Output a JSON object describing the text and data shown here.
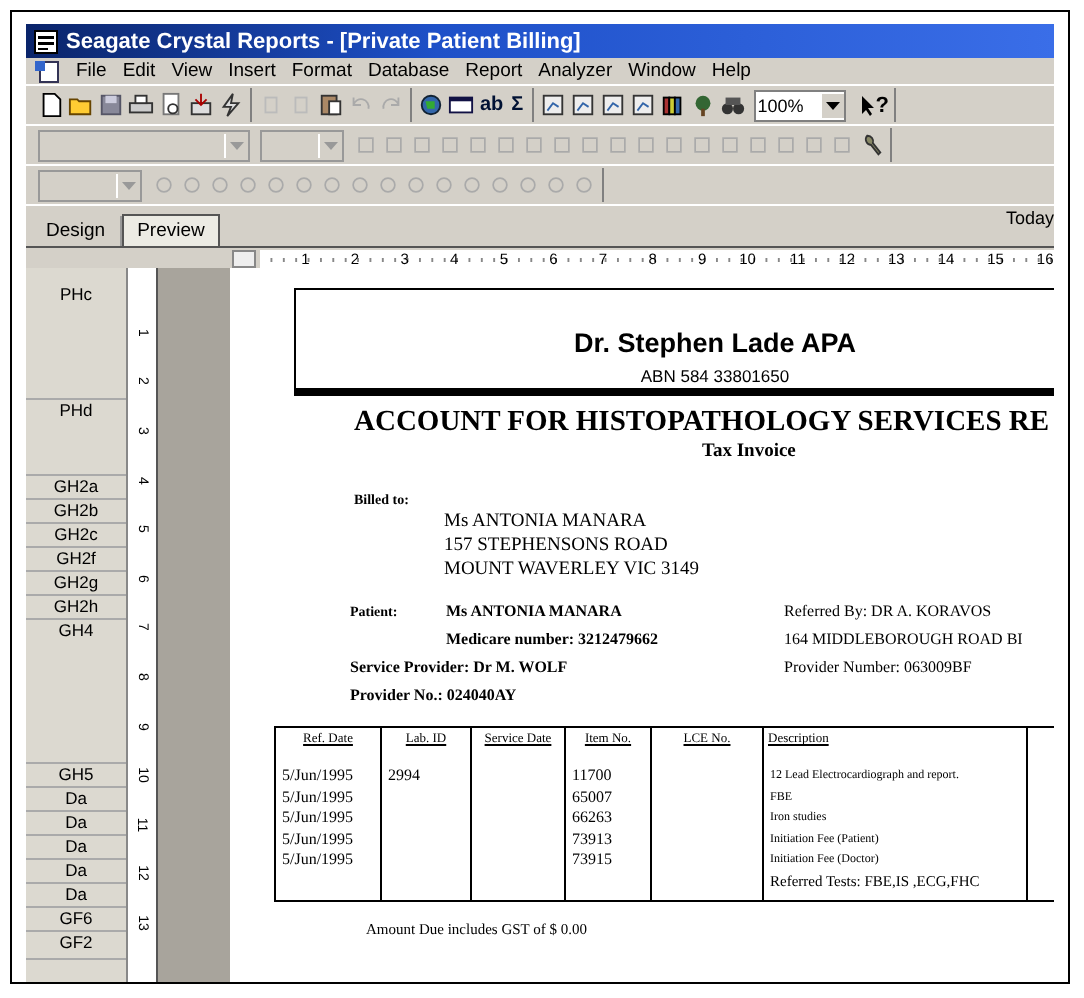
{
  "window": {
    "title": "Seagate Crystal Reports - [Private Patient Billing]"
  },
  "menu": [
    "File",
    "Edit",
    "View",
    "Insert",
    "Format",
    "Database",
    "Report",
    "Analyzer",
    "Window",
    "Help"
  ],
  "toolbar": {
    "text_tools": [
      "ab",
      "Σ"
    ],
    "zoom": "100%",
    "help": "?"
  },
  "tabs": [
    {
      "label": "Design",
      "selected": false
    },
    {
      "label": "Preview",
      "selected": true
    }
  ],
  "date_label": "Today",
  "ruler": [
    "1",
    "2",
    "3",
    "4",
    "5",
    "6",
    "7",
    "8",
    "9",
    "10",
    "11",
    "12",
    "13",
    "14",
    "15",
    "16"
  ],
  "vertical_ruler": [
    "1",
    "2",
    "3",
    "4",
    "5",
    "6",
    "7",
    "8",
    "9",
    "10",
    "11",
    "12",
    "13"
  ],
  "sections": [
    "PHc",
    "PHd",
    "GH2a",
    "GH2b",
    "GH2c",
    "GH2f",
    "GH2g",
    "GH2h",
    "GH4",
    "GH5",
    "Da",
    "Da",
    "Da",
    "Da",
    "Da",
    "GF6",
    "GF2"
  ],
  "report": {
    "practice": "Dr. Stephen Lade APA",
    "abn": "ABN 584 33801650",
    "title": "ACCOUNT FOR  HISTOPATHOLOGY SERVICES RE",
    "subtitle": "Tax Invoice",
    "billed_to_label": "Billed to:",
    "address": [
      "Ms ANTONIA MANARA",
      "157 STEPHENSONS ROAD",
      "MOUNT WAVERLEY VIC 3149"
    ],
    "patient_label": "Patient:",
    "patient": "Ms ANTONIA MANARA",
    "medicare": "Medicare number: 3212479662",
    "service_provider": "Service Provider: Dr M. WOLF",
    "provider_no": "Provider No.: 024040AY",
    "referred_by": "Referred By: DR A. KORAVOS",
    "referrer_address": "164 MIDDLEBOROUGH ROAD BI",
    "provider_number": "Provider Number: 063009BF",
    "columns": [
      "Ref. Date",
      "Lab. ID",
      "Service Date",
      "Item No.",
      "LCE No.",
      "Description"
    ],
    "rows": [
      [
        "5/Jun/1995",
        "2994",
        null,
        "11700",
        null,
        "12 Lead Electrocardiograph and report."
      ],
      [
        "5/Jun/1995",
        null,
        null,
        "65007",
        null,
        "FBE"
      ],
      [
        "5/Jun/1995",
        null,
        null,
        "66263",
        null,
        "Iron studies"
      ],
      [
        "5/Jun/1995",
        null,
        null,
        "73913",
        null,
        "Initiation Fee (Patient)"
      ],
      [
        "5/Jun/1995",
        null,
        null,
        "73915",
        null,
        "Initiation Fee (Doctor)"
      ],
      [
        null,
        null,
        null,
        null,
        null,
        "Referred Tests: FBE,IS ,ECG,FHC"
      ]
    ],
    "amount_due": "Amount Due includes GST of $ 0.00"
  }
}
